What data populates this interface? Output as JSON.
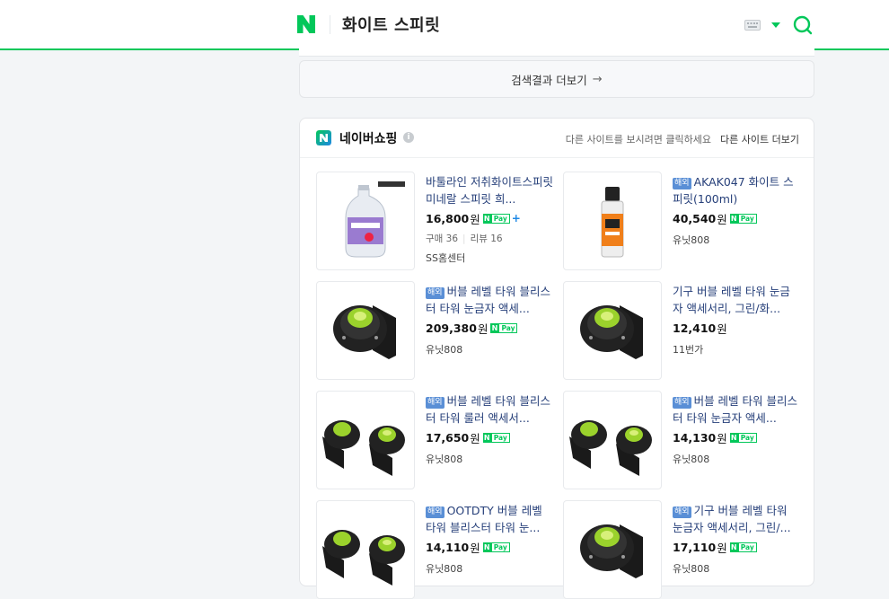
{
  "header": {
    "logo_letter": "N",
    "query": "화이트 스피릿",
    "brand_color": "#03c75a"
  },
  "more_results": {
    "label": "검색결과 더보기",
    "arrow": "→"
  },
  "shopping": {
    "title": "네이버쇼핑",
    "info_glyph": "i",
    "other_sites_message": "다른 사이트를 보시려면 클릭하세요",
    "other_sites_link": "다른 사이트 더보기",
    "overseas_badge": "해외",
    "currency": "원",
    "npay": {
      "n": "N",
      "pay": "Pay",
      "plus": "+"
    },
    "items": [
      {
        "title": "바툴라인 저취화이트스피릿 미네랄 스피릿 희...",
        "badge": false,
        "price": "16,800",
        "plus": true,
        "purchases_label": "구매 36",
        "reviews_label": "리뷰 16",
        "seller": "SS홈센터",
        "image": "bottle-icon"
      },
      {
        "title": "AKAK047 화이트 스피릿(100ml)",
        "badge": true,
        "price": "40,540",
        "plus": false,
        "seller": "유닛808",
        "image": "small-bottle-icon"
      },
      {
        "title": "버블 레벨 타워 블리스터 타워 눈금자 액세...",
        "badge": true,
        "price": "209,380",
        "plus": false,
        "seller": "유닛808",
        "image": "bubble-level-icon"
      },
      {
        "title": "기구 버블 레벨 타워 눈금자 액세서리, 그린/화...",
        "badge": false,
        "price": "12,410",
        "plus": false,
        "nopay": true,
        "seller": "11번가",
        "image": "bubble-level-icon"
      },
      {
        "title": "버블 레벨 타워 블리스 터 타워 룰러 액세서...",
        "badge": true,
        "price": "17,650",
        "plus": false,
        "seller": "유닛808",
        "image": "double-bubble-level-icon"
      },
      {
        "title": "버블 레벨 타워 블리스터 타워 눈금자 액세...",
        "badge": true,
        "price": "14,130",
        "plus": false,
        "seller": "유닛808",
        "image": "double-bubble-level-icon"
      },
      {
        "title": "OOTDTY 버블 레벨 타워 블리스터 타워 눈...",
        "badge": true,
        "price": "14,110",
        "plus": false,
        "seller": "유닛808",
        "image": "double-bubble-level-icon"
      },
      {
        "title": "기구 버블 레벨 타워 눈금자 액세서리, 그린/...",
        "badge": true,
        "price": "17,110",
        "plus": false,
        "seller": "유닛808",
        "image": "bubble-level-icon"
      }
    ]
  }
}
